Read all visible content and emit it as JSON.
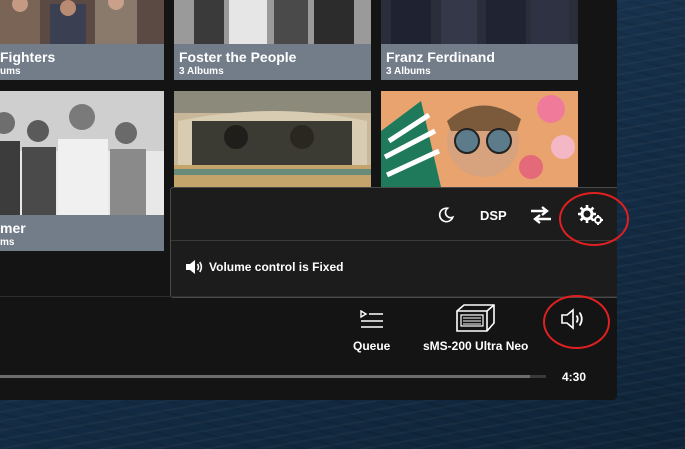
{
  "albums": [
    {
      "name": "Fighters",
      "count": "ums"
    },
    {
      "name": "Foster the People",
      "count": "3 Albums"
    },
    {
      "name": "Franz Ferdinand",
      "count": "3 Albums"
    },
    {
      "name": "mer",
      "count": "ms"
    }
  ],
  "popup": {
    "dsp_label": "DSP",
    "volume_status": "Volume control is Fixed",
    "icons": [
      "moon-icon",
      "swap-arrows-icon",
      "gears-icon",
      "speaker-icon"
    ]
  },
  "player": {
    "queue_label": "Queue",
    "device_label": "sMS-200 Ultra Neo",
    "time": "4:30",
    "progress": 0.97
  },
  "colors": {
    "highlight": "#e02020",
    "caption_bg": "#737d8a",
    "panel_bg": "#141414"
  }
}
